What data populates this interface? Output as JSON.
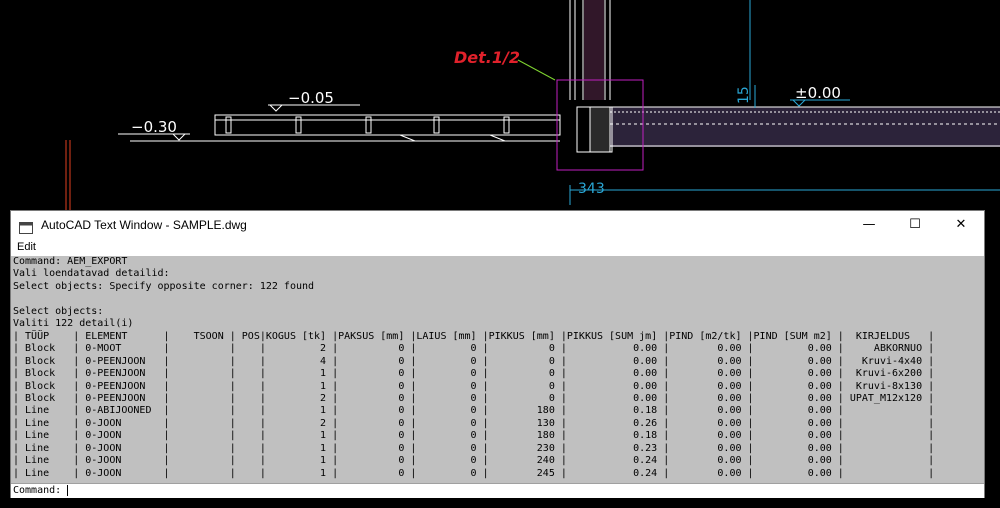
{
  "drawing": {
    "det_label": "Det.1/2",
    "level_label_1": "−0.05",
    "level_label_2": "−0.30",
    "level_label_3": "±0.00",
    "dim_label_1": "343",
    "dim_label_2": "15"
  },
  "window": {
    "title": "AutoCAD Text Window - SAMPLE.dwg",
    "minimize_glyph": "—",
    "maximize_glyph": "☐",
    "close_glyph": "✕"
  },
  "menu": {
    "edit": "Edit"
  },
  "history": {
    "lines": [
      "Command: AEM_EXPORT",
      "Vali loendatavad detailid:",
      "Select objects: Specify opposite corner: 122 found",
      "",
      "Select objects:",
      "Valiti 122 detail(i)"
    ]
  },
  "table": {
    "columns": [
      "TÜÜP",
      "ELEMENT",
      "TSOON",
      "POS",
      "KOGUS [tk]",
      "PAKSUS [mm]",
      "LAIUS [mm]",
      "PIKKUS [mm]",
      "PIKKUS [SUM jm]",
      "PIND [m2/tk]",
      "PIND [SUM m2]",
      "KIRJELDUS"
    ],
    "rows": [
      [
        "Block",
        "0-MOOT",
        "",
        "",
        "2",
        "0",
        "0",
        "0",
        "0.00",
        "0.00",
        "0.00",
        "ABKORNUO"
      ],
      [
        "Block",
        "0-PEENJOON",
        "",
        "",
        "4",
        "0",
        "0",
        "0",
        "0.00",
        "0.00",
        "0.00",
        "Kruvi-4x40"
      ],
      [
        "Block",
        "0-PEENJOON",
        "",
        "",
        "1",
        "0",
        "0",
        "0",
        "0.00",
        "0.00",
        "0.00",
        "Kruvi-6x200"
      ],
      [
        "Block",
        "0-PEENJOON",
        "",
        "",
        "1",
        "0",
        "0",
        "0",
        "0.00",
        "0.00",
        "0.00",
        "Kruvi-8x130"
      ],
      [
        "Block",
        "0-PEENJOON",
        "",
        "",
        "2",
        "0",
        "0",
        "0",
        "0.00",
        "0.00",
        "0.00",
        "UPAT_M12x120"
      ],
      [
        "Line",
        "0-ABIJOONED",
        "",
        "",
        "1",
        "0",
        "0",
        "180",
        "0.18",
        "0.00",
        "0.00",
        ""
      ],
      [
        "Line",
        "0-JOON",
        "",
        "",
        "2",
        "0",
        "0",
        "130",
        "0.26",
        "0.00",
        "0.00",
        ""
      ],
      [
        "Line",
        "0-JOON",
        "",
        "",
        "1",
        "0",
        "0",
        "180",
        "0.18",
        "0.00",
        "0.00",
        ""
      ],
      [
        "Line",
        "0-JOON",
        "",
        "",
        "1",
        "0",
        "0",
        "230",
        "0.23",
        "0.00",
        "0.00",
        ""
      ],
      [
        "Line",
        "0-JOON",
        "",
        "",
        "1",
        "0",
        "0",
        "240",
        "0.24",
        "0.00",
        "0.00",
        ""
      ],
      [
        "Line",
        "0-JOON",
        "",
        "",
        "1",
        "0",
        "0",
        "245",
        "0.24",
        "0.00",
        "0.00",
        ""
      ]
    ]
  },
  "command_line": {
    "prompt": "Command:"
  }
}
